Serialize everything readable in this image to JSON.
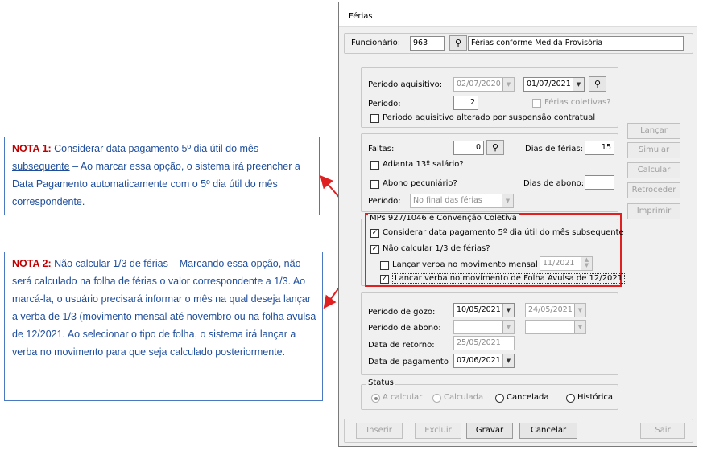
{
  "notes": {
    "note1": {
      "prefix": "NOTA 1:",
      "title": "Considerar data pagamento 5º dia útil do mês subsequente",
      "body": " – Ao marcar essa opção, o sistema irá preencher a Data Pagamento automaticamente com o 5º dia útil do mês correspondente."
    },
    "note2": {
      "prefix": "NOTA 2:",
      "title": "Não calcular 1/3 de férias",
      "body": " – Marcando essa opção, não será calculado na folha de férias o valor correspondente a 1/3. Ao marcá-la, o usuário precisará informar o mês na qual deseja lançar a verba de 1/3 (movimento mensal até novembro ou na folha avulsa de 12/2021. Ao selecionar o tipo de folha, o sistema irá lançar a verba no movimento para que seja calculado posteriormente."
    }
  },
  "window": {
    "title": "Férias"
  },
  "funcionario": {
    "label": "Funcionário:",
    "code": "963",
    "name": "Férias conforme Medida Provisória"
  },
  "periodo_aquisitivo": {
    "label": "Período aquisitivo:",
    "start": "02/07/2020",
    "end": "01/07/2021",
    "periodo_label": "Período:",
    "periodo_value": "2",
    "ferias_coletivas": "Férias coletivas?",
    "alterado_label": "Periodo aquisitivo alterado por suspensão contratual"
  },
  "faltas": {
    "label": "Faltas:",
    "value": "0",
    "dias_ferias_label": "Dias de férias:",
    "dias_ferias_value": "15",
    "adianta_label": "Adianta 13º salário?",
    "abono_label": "Abono pecuniário?",
    "dias_abono_label": "Dias de abono:",
    "dias_abono_value": "",
    "periodo_label": "Período:",
    "periodo_value": "No final das férias"
  },
  "mps": {
    "legend": "MPs 927/1046 e Convenção Coletiva",
    "considerar_label": "Considerar data pagamento 5º dia útil do mês subsequente",
    "nao_calcular_label": "Não calcular 1/3 de férias?",
    "lancar_mensal_label": "Lançar verba  no movimento mensal :",
    "lancar_mensal_value": "11/2021",
    "lancar_avulsa_label": "Lancar verba no movimento de Folha Avulsa de 12/2021"
  },
  "gozo": {
    "periodo_gozo_label": "Período de gozo:",
    "gozo_start": "10/05/2021",
    "gozo_end": "24/05/2021",
    "periodo_abono_label": "Período de abono:",
    "retorno_label": "Data de retorno:",
    "retorno_value": "25/05/2021",
    "pagamento_label": "Data de pagamento",
    "pagamento_value": "07/06/2021"
  },
  "status": {
    "legend": "Status",
    "options": [
      "A calcular",
      "Calculada",
      "Cancelada",
      "Histórica"
    ]
  },
  "side_buttons": [
    "Lançar",
    "Simular",
    "Calcular",
    "Retroceder",
    "Imprimir"
  ],
  "bottom_buttons": {
    "inserir": "Inserir",
    "excluir": "Excluir",
    "gravar": "Gravar",
    "cancelar": "Cancelar",
    "sair": "Sair"
  },
  "icons": {
    "binoculars": "binoculars-icon",
    "dropdown": "chevron-down-icon",
    "spinner": "spinner-icon"
  },
  "colors": {
    "annotation_border": "#e02020",
    "note_text": "#1f4e9c",
    "note_prefix": "#c00000"
  }
}
